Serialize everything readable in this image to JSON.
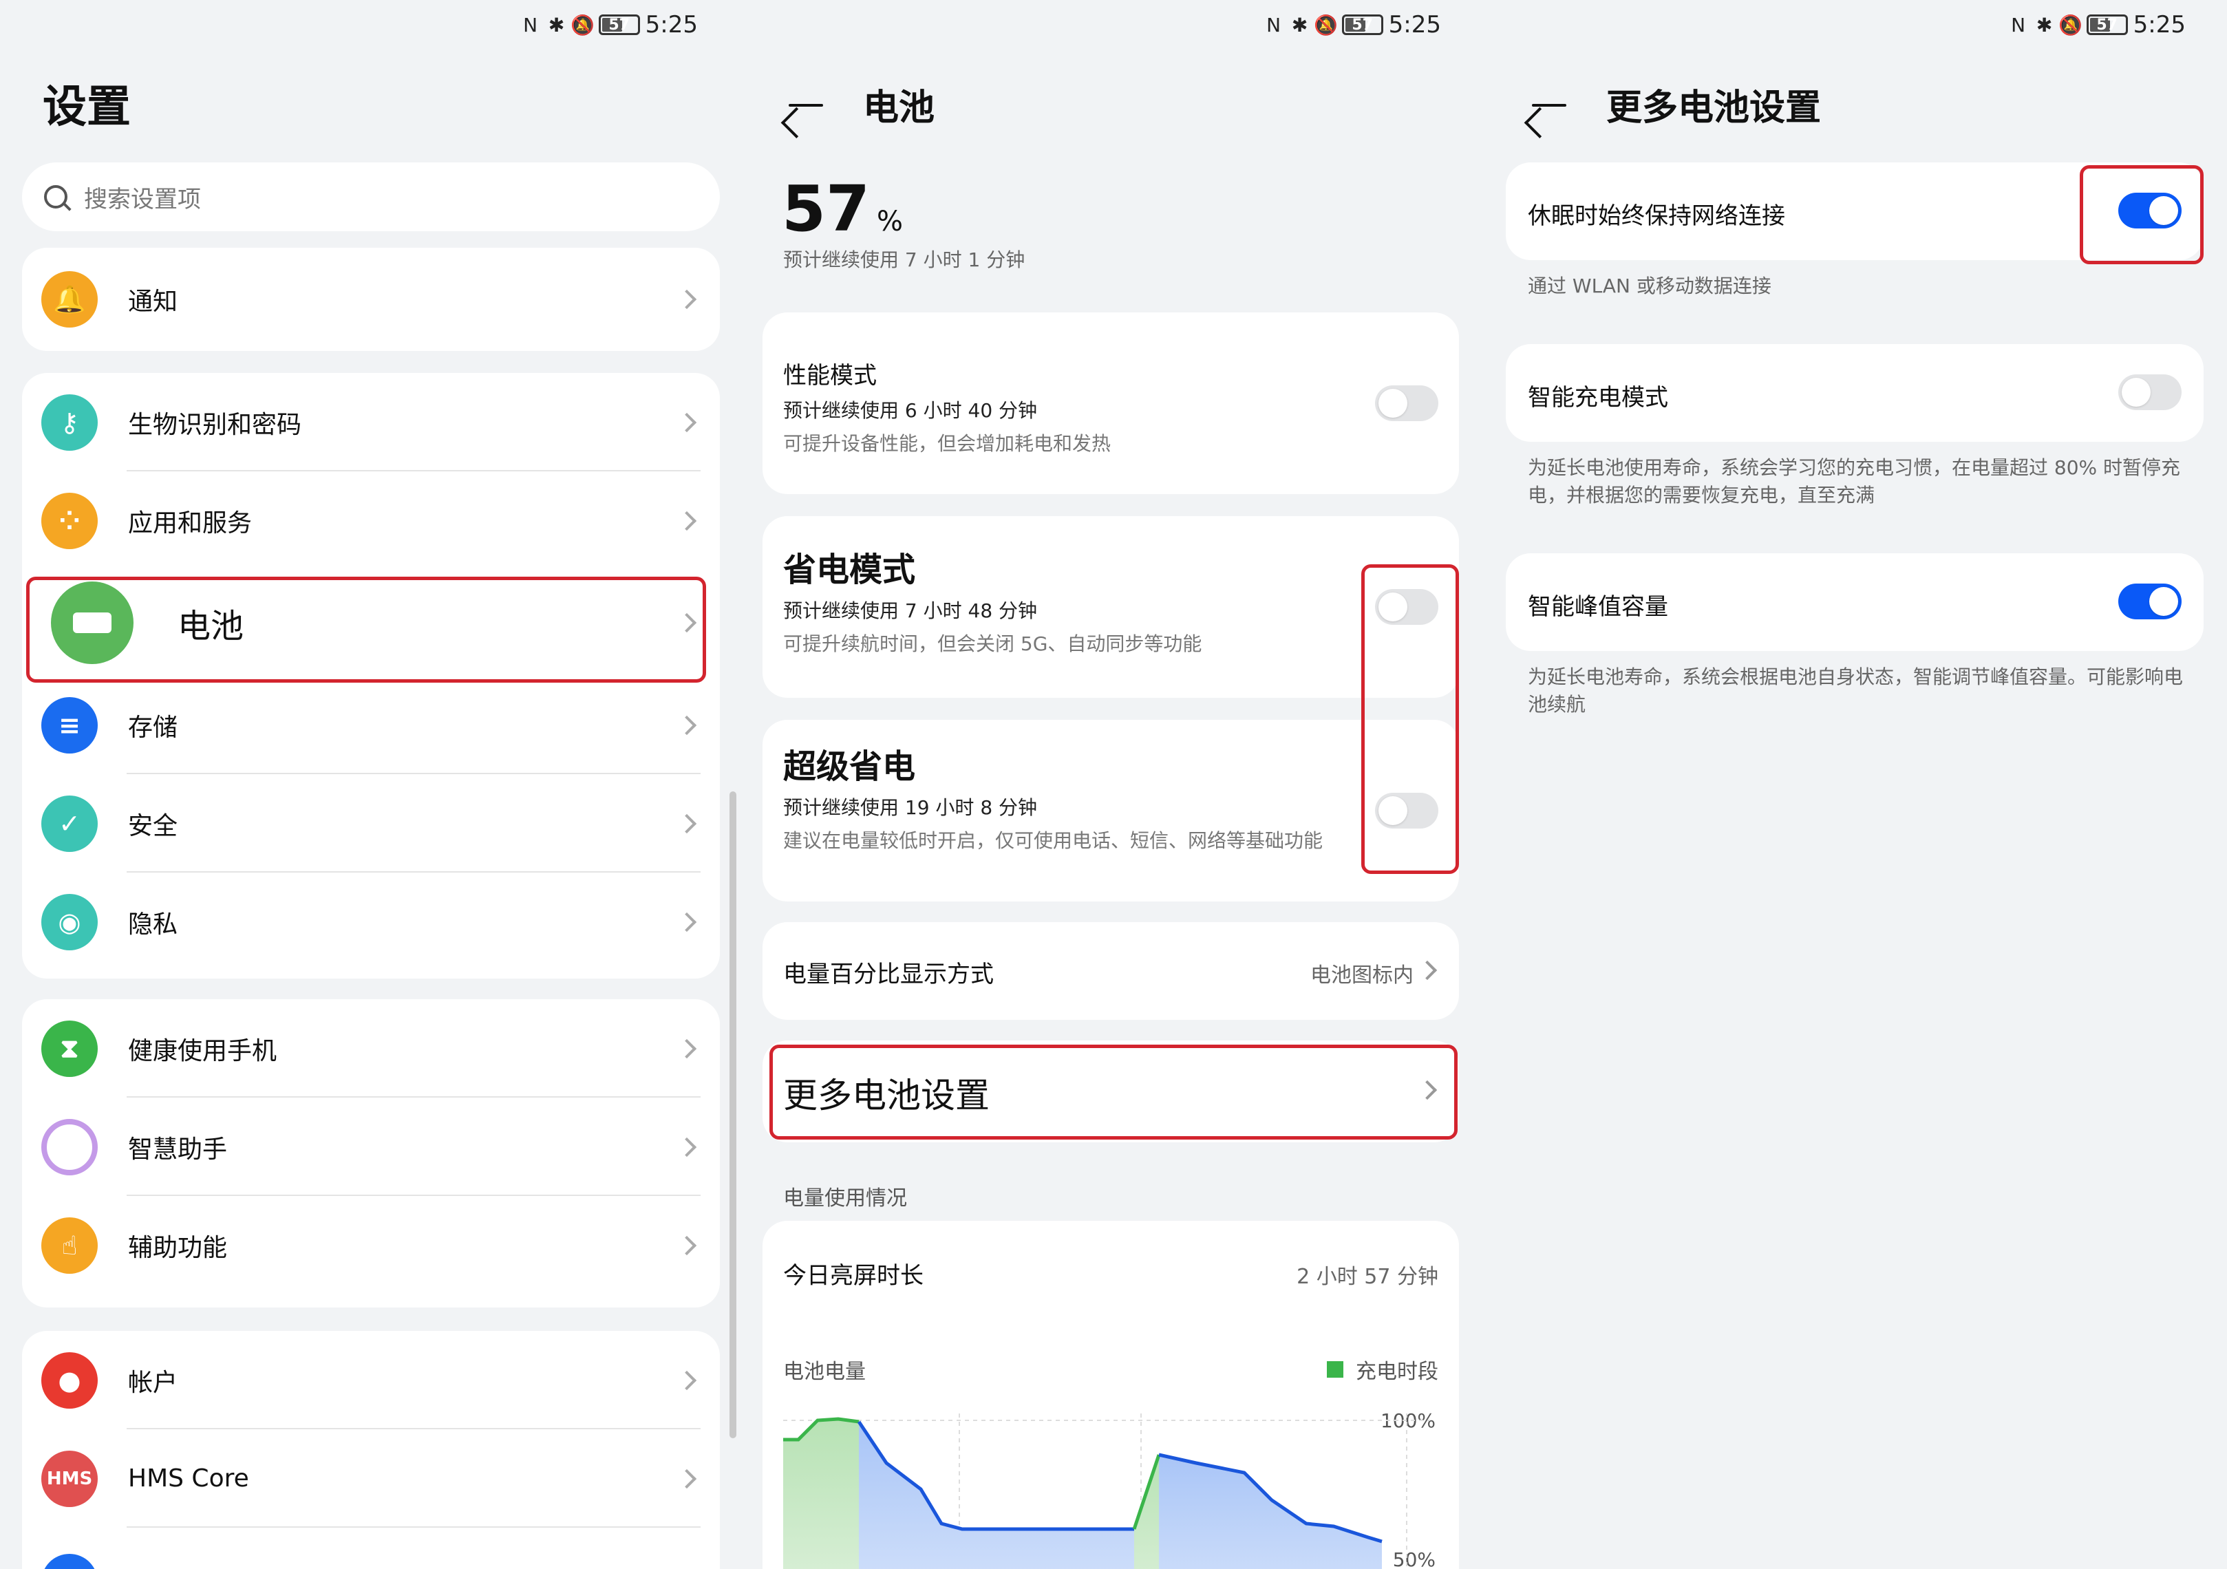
{
  "status": {
    "time": "5:25",
    "battery": "57"
  },
  "settings": {
    "title": "设置",
    "search_placeholder": "搜索设置项",
    "groups": [
      [
        {
          "label": "通知",
          "icon": "bell-icon",
          "color": "#f5a623"
        }
      ],
      [
        {
          "label": "生物识别和密码",
          "icon": "key-icon",
          "color": "#3cc4b4"
        },
        {
          "label": "应用和服务",
          "icon": "apps-icon",
          "color": "#f5a623"
        },
        {
          "label": "电池",
          "icon": "battery-icon",
          "color": "#5ab75a"
        },
        {
          "label": "存储",
          "icon": "storage-icon",
          "color": "#1a6cf0"
        },
        {
          "label": "安全",
          "icon": "shield-icon",
          "color": "#3cc4b4"
        },
        {
          "label": "隐私",
          "icon": "privacy-icon",
          "color": "#3cc4b4"
        }
      ],
      [
        {
          "label": "健康使用手机",
          "icon": "hourglass-icon",
          "color": "#3ab54a"
        },
        {
          "label": "智慧助手",
          "icon": "assistant-icon",
          "color": "#c070e0"
        },
        {
          "label": "辅助功能",
          "icon": "hand-icon",
          "color": "#f5a623"
        }
      ],
      [
        {
          "label": "帐户",
          "icon": "account-icon",
          "color": "#e8392f"
        },
        {
          "label": "HMS Core",
          "icon": "hms-icon",
          "color": "#e05050",
          "badge": "HMS"
        }
      ]
    ]
  },
  "battery": {
    "title": "电池",
    "percent": "57",
    "percent_unit": "%",
    "remaining": "预计继续使用 7 小时 1 分钟",
    "performance": {
      "title": "性能模式",
      "line1": "预计继续使用 6 小时 40 分钟",
      "line2": "可提升设备性能，但会增加耗电和发热"
    },
    "power_save": {
      "title": "省电模式",
      "line1": "预计继续使用 7 小时 48 分钟",
      "line2": "可提升续航时间，但会关闭 5G、自动同步等功能"
    },
    "super_save": {
      "title": "超级省电",
      "line1": "预计继续使用 19 小时 8 分钟",
      "line2": "建议在电量较低时开启，仅可使用电话、短信、网络等基础功能"
    },
    "percent_display": {
      "title": "电量百分比显示方式",
      "value": "电池图标内"
    },
    "more": "更多电池设置",
    "usage_label": "电量使用情况",
    "screen_on": {
      "title": "今日亮屏时长",
      "value": "2 小时 57 分钟"
    },
    "chart_label": "电池电量",
    "legend": "充电时段",
    "y100": "100%",
    "y50": "50%"
  },
  "more_settings": {
    "title": "更多电池设置",
    "keep_network": {
      "title": "休眠时始终保持网络连接",
      "desc": "通过 WLAN 或移动数据连接"
    },
    "smart_charge": {
      "title": "智能充电模式",
      "desc": "为延长电池使用寿命，系统会学习您的充电习惯，在电量超过 80% 时暂停充电，并根据您的需要恢复充电，直至充满"
    },
    "peak_capacity": {
      "title": "智能峰值容量",
      "desc": "为延长电池寿命，系统会根据电池自身状态，智能调节峰值容量。可能影响电池续航"
    }
  },
  "colors": {
    "accent": "#0a59f7",
    "highlight": "#d3242e",
    "charge": "#3ab54a"
  }
}
